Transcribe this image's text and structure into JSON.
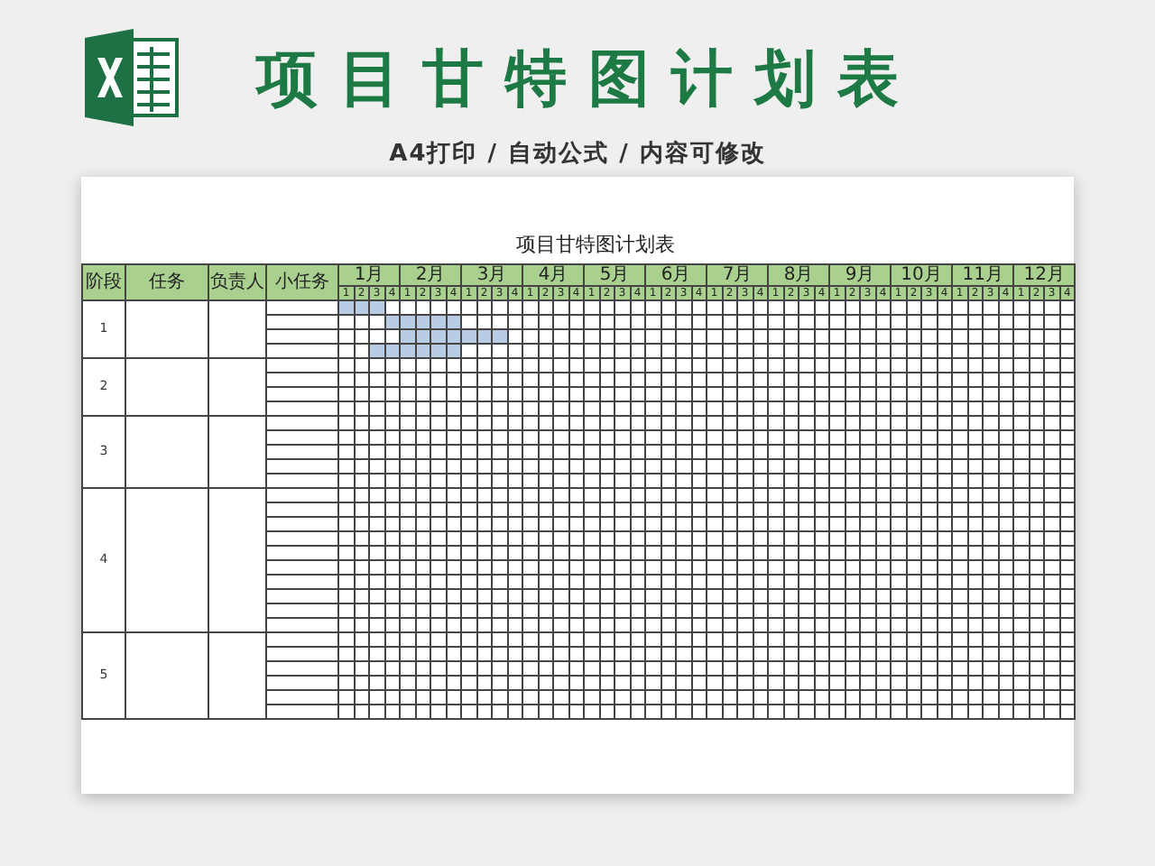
{
  "banner": {
    "title": "项目甘特图计划表",
    "subtitle": "A4打印 / 自动公式 / 内容可修改"
  },
  "sheet": {
    "title": "项目甘特图计划表",
    "columns": [
      "阶段",
      "任务",
      "负责人",
      "小任务"
    ],
    "months": [
      {
        "label": "1月",
        "weeks": [
          "1",
          "2",
          "3",
          "4"
        ]
      },
      {
        "label": "2月",
        "weeks": [
          "1",
          "2",
          "3",
          "4"
        ]
      },
      {
        "label": "3月",
        "weeks": [
          "1",
          "2",
          "3",
          "4"
        ]
      },
      {
        "label": "4月",
        "weeks": [
          "1",
          "2",
          "3",
          "4"
        ]
      },
      {
        "label": "5月",
        "weeks": [
          "1",
          "2",
          "3",
          "4"
        ]
      },
      {
        "label": "6月",
        "weeks": [
          "1",
          "2",
          "3",
          "4"
        ]
      },
      {
        "label": "7月",
        "weeks": [
          "1",
          "2",
          "3",
          "4"
        ]
      },
      {
        "label": "8月",
        "weeks": [
          "1",
          "2",
          "3",
          "4"
        ]
      },
      {
        "label": "9月",
        "weeks": [
          "1",
          "2",
          "3",
          "4"
        ]
      },
      {
        "label": "10月",
        "weeks": [
          "1",
          "2",
          "3",
          "4"
        ]
      },
      {
        "label": "11月",
        "weeks": [
          "1",
          "2",
          "3",
          "4"
        ]
      },
      {
        "label": "12月",
        "weeks": [
          "1",
          "2",
          "3",
          "4"
        ]
      }
    ],
    "stages": [
      {
        "number": "1",
        "rows": [
          {
            "shaded": [
              true,
              true,
              true,
              false,
              false,
              false,
              false,
              false,
              false,
              false,
              false,
              false,
              false,
              false,
              false,
              false,
              false,
              false,
              false,
              false,
              false,
              false,
              false,
              false,
              false,
              false,
              false,
              false,
              false,
              false,
              false,
              false,
              false,
              false,
              false,
              false,
              false,
              false,
              false,
              false,
              false,
              false,
              false,
              false,
              false,
              false,
              false,
              false
            ]
          },
          {
            "shaded": [
              false,
              false,
              false,
              true,
              true,
              true,
              true,
              true,
              false,
              false,
              false,
              false,
              false,
              false,
              false,
              false,
              false,
              false,
              false,
              false,
              false,
              false,
              false,
              false,
              false,
              false,
              false,
              false,
              false,
              false,
              false,
              false,
              false,
              false,
              false,
              false,
              false,
              false,
              false,
              false,
              false,
              false,
              false,
              false,
              false,
              false,
              false,
              false
            ]
          },
          {
            "shaded": [
              false,
              false,
              false,
              false,
              true,
              true,
              true,
              true,
              true,
              true,
              true,
              false,
              false,
              false,
              false,
              false,
              false,
              false,
              false,
              false,
              false,
              false,
              false,
              false,
              false,
              false,
              false,
              false,
              false,
              false,
              false,
              false,
              false,
              false,
              false,
              false,
              false,
              false,
              false,
              false,
              false,
              false,
              false,
              false,
              false,
              false,
              false,
              false
            ]
          },
          {
            "shaded": [
              false,
              false,
              true,
              true,
              true,
              true,
              true,
              true,
              false,
              false,
              false,
              false,
              false,
              false,
              false,
              false,
              false,
              false,
              false,
              false,
              false,
              false,
              false,
              false,
              false,
              false,
              false,
              false,
              false,
              false,
              false,
              false,
              false,
              false,
              false,
              false,
              false,
              false,
              false,
              false,
              false,
              false,
              false,
              false,
              false,
              false,
              false,
              false
            ]
          }
        ]
      },
      {
        "number": "2",
        "rows": [
          {
            "shaded": [
              false,
              false,
              false,
              false,
              false,
              false,
              false,
              false,
              false,
              false,
              false,
              false,
              false,
              false,
              false,
              false,
              false,
              false,
              false,
              false,
              false,
              false,
              false,
              false,
              false,
              false,
              false,
              false,
              false,
              false,
              false,
              false,
              false,
              false,
              false,
              false,
              false,
              false,
              false,
              false,
              false,
              false,
              false,
              false,
              false,
              false,
              false,
              false
            ]
          },
          {
            "shaded": [
              false,
              false,
              false,
              false,
              false,
              false,
              false,
              false,
              false,
              false,
              false,
              false,
              false,
              false,
              false,
              false,
              false,
              false,
              false,
              false,
              false,
              false,
              false,
              false,
              false,
              false,
              false,
              false,
              false,
              false,
              false,
              false,
              false,
              false,
              false,
              false,
              false,
              false,
              false,
              false,
              false,
              false,
              false,
              false,
              false,
              false,
              false,
              false
            ]
          },
          {
            "shaded": [
              false,
              false,
              false,
              false,
              false,
              false,
              false,
              false,
              false,
              false,
              false,
              false,
              false,
              false,
              false,
              false,
              false,
              false,
              false,
              false,
              false,
              false,
              false,
              false,
              false,
              false,
              false,
              false,
              false,
              false,
              false,
              false,
              false,
              false,
              false,
              false,
              false,
              false,
              false,
              false,
              false,
              false,
              false,
              false,
              false,
              false,
              false,
              false
            ]
          },
          {
            "shaded": [
              false,
              false,
              false,
              false,
              false,
              false,
              false,
              false,
              false,
              false,
              false,
              false,
              false,
              false,
              false,
              false,
              false,
              false,
              false,
              false,
              false,
              false,
              false,
              false,
              false,
              false,
              false,
              false,
              false,
              false,
              false,
              false,
              false,
              false,
              false,
              false,
              false,
              false,
              false,
              false,
              false,
              false,
              false,
              false,
              false,
              false,
              false,
              false
            ]
          }
        ]
      },
      {
        "number": "3",
        "rows": [
          {
            "shaded": [
              false,
              false,
              false,
              false,
              false,
              false,
              false,
              false,
              false,
              false,
              false,
              false,
              false,
              false,
              false,
              false,
              false,
              false,
              false,
              false,
              false,
              false,
              false,
              false,
              false,
              false,
              false,
              false,
              false,
              false,
              false,
              false,
              false,
              false,
              false,
              false,
              false,
              false,
              false,
              false,
              false,
              false,
              false,
              false,
              false,
              false,
              false,
              false
            ]
          },
          {
            "shaded": [
              false,
              false,
              false,
              false,
              false,
              false,
              false,
              false,
              false,
              false,
              false,
              false,
              false,
              false,
              false,
              false,
              false,
              false,
              false,
              false,
              false,
              false,
              false,
              false,
              false,
              false,
              false,
              false,
              false,
              false,
              false,
              false,
              false,
              false,
              false,
              false,
              false,
              false,
              false,
              false,
              false,
              false,
              false,
              false,
              false,
              false,
              false,
              false
            ]
          },
          {
            "shaded": [
              false,
              false,
              false,
              false,
              false,
              false,
              false,
              false,
              false,
              false,
              false,
              false,
              false,
              false,
              false,
              false,
              false,
              false,
              false,
              false,
              false,
              false,
              false,
              false,
              false,
              false,
              false,
              false,
              false,
              false,
              false,
              false,
              false,
              false,
              false,
              false,
              false,
              false,
              false,
              false,
              false,
              false,
              false,
              false,
              false,
              false,
              false,
              false
            ]
          },
          {
            "shaded": [
              false,
              false,
              false,
              false,
              false,
              false,
              false,
              false,
              false,
              false,
              false,
              false,
              false,
              false,
              false,
              false,
              false,
              false,
              false,
              false,
              false,
              false,
              false,
              false,
              false,
              false,
              false,
              false,
              false,
              false,
              false,
              false,
              false,
              false,
              false,
              false,
              false,
              false,
              false,
              false,
              false,
              false,
              false,
              false,
              false,
              false,
              false,
              false
            ]
          },
          {
            "shaded": [
              false,
              false,
              false,
              false,
              false,
              false,
              false,
              false,
              false,
              false,
              false,
              false,
              false,
              false,
              false,
              false,
              false,
              false,
              false,
              false,
              false,
              false,
              false,
              false,
              false,
              false,
              false,
              false,
              false,
              false,
              false,
              false,
              false,
              false,
              false,
              false,
              false,
              false,
              false,
              false,
              false,
              false,
              false,
              false,
              false,
              false,
              false,
              false
            ]
          }
        ]
      },
      {
        "number": "4",
        "rows": [
          {
            "shaded": [
              false,
              false,
              false,
              false,
              false,
              false,
              false,
              false,
              false,
              false,
              false,
              false,
              false,
              false,
              false,
              false,
              false,
              false,
              false,
              false,
              false,
              false,
              false,
              false,
              false,
              false,
              false,
              false,
              false,
              false,
              false,
              false,
              false,
              false,
              false,
              false,
              false,
              false,
              false,
              false,
              false,
              false,
              false,
              false,
              false,
              false,
              false,
              false
            ]
          },
          {
            "shaded": [
              false,
              false,
              false,
              false,
              false,
              false,
              false,
              false,
              false,
              false,
              false,
              false,
              false,
              false,
              false,
              false,
              false,
              false,
              false,
              false,
              false,
              false,
              false,
              false,
              false,
              false,
              false,
              false,
              false,
              false,
              false,
              false,
              false,
              false,
              false,
              false,
              false,
              false,
              false,
              false,
              false,
              false,
              false,
              false,
              false,
              false,
              false,
              false
            ]
          },
          {
            "shaded": [
              false,
              false,
              false,
              false,
              false,
              false,
              false,
              false,
              false,
              false,
              false,
              false,
              false,
              false,
              false,
              false,
              false,
              false,
              false,
              false,
              false,
              false,
              false,
              false,
              false,
              false,
              false,
              false,
              false,
              false,
              false,
              false,
              false,
              false,
              false,
              false,
              false,
              false,
              false,
              false,
              false,
              false,
              false,
              false,
              false,
              false,
              false,
              false
            ]
          },
          {
            "shaded": [
              false,
              false,
              false,
              false,
              false,
              false,
              false,
              false,
              false,
              false,
              false,
              false,
              false,
              false,
              false,
              false,
              false,
              false,
              false,
              false,
              false,
              false,
              false,
              false,
              false,
              false,
              false,
              false,
              false,
              false,
              false,
              false,
              false,
              false,
              false,
              false,
              false,
              false,
              false,
              false,
              false,
              false,
              false,
              false,
              false,
              false,
              false,
              false
            ]
          },
          {
            "shaded": [
              false,
              false,
              false,
              false,
              false,
              false,
              false,
              false,
              false,
              false,
              false,
              false,
              false,
              false,
              false,
              false,
              false,
              false,
              false,
              false,
              false,
              false,
              false,
              false,
              false,
              false,
              false,
              false,
              false,
              false,
              false,
              false,
              false,
              false,
              false,
              false,
              false,
              false,
              false,
              false,
              false,
              false,
              false,
              false,
              false,
              false,
              false,
              false
            ]
          },
          {
            "shaded": [
              false,
              false,
              false,
              false,
              false,
              false,
              false,
              false,
              false,
              false,
              false,
              false,
              false,
              false,
              false,
              false,
              false,
              false,
              false,
              false,
              false,
              false,
              false,
              false,
              false,
              false,
              false,
              false,
              false,
              false,
              false,
              false,
              false,
              false,
              false,
              false,
              false,
              false,
              false,
              false,
              false,
              false,
              false,
              false,
              false,
              false,
              false,
              false
            ]
          },
          {
            "shaded": [
              false,
              false,
              false,
              false,
              false,
              false,
              false,
              false,
              false,
              false,
              false,
              false,
              false,
              false,
              false,
              false,
              false,
              false,
              false,
              false,
              false,
              false,
              false,
              false,
              false,
              false,
              false,
              false,
              false,
              false,
              false,
              false,
              false,
              false,
              false,
              false,
              false,
              false,
              false,
              false,
              false,
              false,
              false,
              false,
              false,
              false,
              false,
              false
            ]
          },
          {
            "shaded": [
              false,
              false,
              false,
              false,
              false,
              false,
              false,
              false,
              false,
              false,
              false,
              false,
              false,
              false,
              false,
              false,
              false,
              false,
              false,
              false,
              false,
              false,
              false,
              false,
              false,
              false,
              false,
              false,
              false,
              false,
              false,
              false,
              false,
              false,
              false,
              false,
              false,
              false,
              false,
              false,
              false,
              false,
              false,
              false,
              false,
              false,
              false,
              false
            ]
          },
          {
            "shaded": [
              false,
              false,
              false,
              false,
              false,
              false,
              false,
              false,
              false,
              false,
              false,
              false,
              false,
              false,
              false,
              false,
              false,
              false,
              false,
              false,
              false,
              false,
              false,
              false,
              false,
              false,
              false,
              false,
              false,
              false,
              false,
              false,
              false,
              false,
              false,
              false,
              false,
              false,
              false,
              false,
              false,
              false,
              false,
              false,
              false,
              false,
              false,
              false
            ]
          },
          {
            "shaded": [
              false,
              false,
              false,
              false,
              false,
              false,
              false,
              false,
              false,
              false,
              false,
              false,
              false,
              false,
              false,
              false,
              false,
              false,
              false,
              false,
              false,
              false,
              false,
              false,
              false,
              false,
              false,
              false,
              false,
              false,
              false,
              false,
              false,
              false,
              false,
              false,
              false,
              false,
              false,
              false,
              false,
              false,
              false,
              false,
              false,
              false,
              false,
              false
            ]
          }
        ]
      },
      {
        "number": "5",
        "rows": [
          {
            "shaded": [
              false,
              false,
              false,
              false,
              false,
              false,
              false,
              false,
              false,
              false,
              false,
              false,
              false,
              false,
              false,
              false,
              false,
              false,
              false,
              false,
              false,
              false,
              false,
              false,
              false,
              false,
              false,
              false,
              false,
              false,
              false,
              false,
              false,
              false,
              false,
              false,
              false,
              false,
              false,
              false,
              false,
              false,
              false,
              false,
              false,
              false,
              false,
              false
            ]
          },
          {
            "shaded": [
              false,
              false,
              false,
              false,
              false,
              false,
              false,
              false,
              false,
              false,
              false,
              false,
              false,
              false,
              false,
              false,
              false,
              false,
              false,
              false,
              false,
              false,
              false,
              false,
              false,
              false,
              false,
              false,
              false,
              false,
              false,
              false,
              false,
              false,
              false,
              false,
              false,
              false,
              false,
              false,
              false,
              false,
              false,
              false,
              false,
              false,
              false,
              false
            ]
          },
          {
            "shaded": [
              false,
              false,
              false,
              false,
              false,
              false,
              false,
              false,
              false,
              false,
              false,
              false,
              false,
              false,
              false,
              false,
              false,
              false,
              false,
              false,
              false,
              false,
              false,
              false,
              false,
              false,
              false,
              false,
              false,
              false,
              false,
              false,
              false,
              false,
              false,
              false,
              false,
              false,
              false,
              false,
              false,
              false,
              false,
              false,
              false,
              false,
              false,
              false
            ]
          },
          {
            "shaded": [
              false,
              false,
              false,
              false,
              false,
              false,
              false,
              false,
              false,
              false,
              false,
              false,
              false,
              false,
              false,
              false,
              false,
              false,
              false,
              false,
              false,
              false,
              false,
              false,
              false,
              false,
              false,
              false,
              false,
              false,
              false,
              false,
              false,
              false,
              false,
              false,
              false,
              false,
              false,
              false,
              false,
              false,
              false,
              false,
              false,
              false,
              false,
              false
            ]
          },
          {
            "shaded": [
              false,
              false,
              false,
              false,
              false,
              false,
              false,
              false,
              false,
              false,
              false,
              false,
              false,
              false,
              false,
              false,
              false,
              false,
              false,
              false,
              false,
              false,
              false,
              false,
              false,
              false,
              false,
              false,
              false,
              false,
              false,
              false,
              false,
              false,
              false,
              false,
              false,
              false,
              false,
              false,
              false,
              false,
              false,
              false,
              false,
              false,
              false,
              false
            ]
          },
          {
            "shaded": [
              false,
              false,
              false,
              false,
              false,
              false,
              false,
              false,
              false,
              false,
              false,
              false,
              false,
              false,
              false,
              false,
              false,
              false,
              false,
              false,
              false,
              false,
              false,
              false,
              false,
              false,
              false,
              false,
              false,
              false,
              false,
              false,
              false,
              false,
              false,
              false,
              false,
              false,
              false,
              false,
              false,
              false,
              false,
              false,
              false,
              false,
              false,
              false
            ]
          }
        ]
      }
    ]
  }
}
